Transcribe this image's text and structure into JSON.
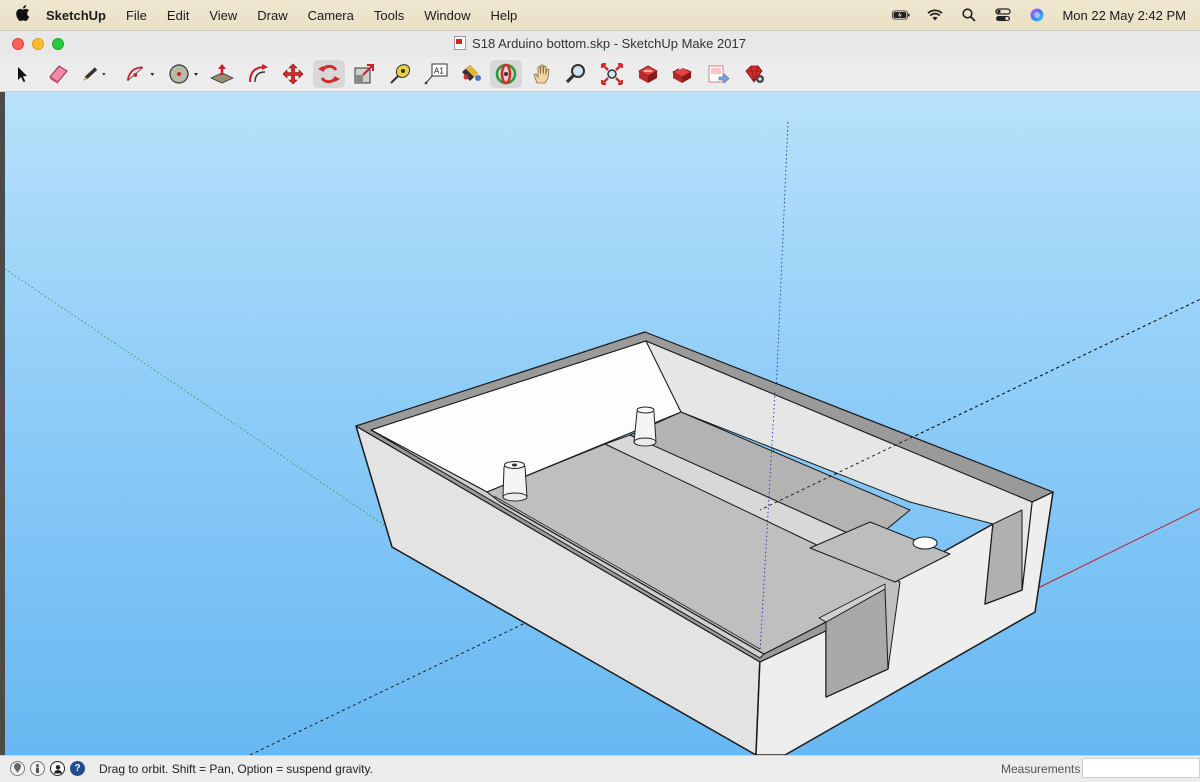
{
  "menubar": {
    "app_name": "SketchUp",
    "menus": [
      "File",
      "Edit",
      "View",
      "Draw",
      "Camera",
      "Tools",
      "Window",
      "Help"
    ],
    "clock": "Mon 22 May  2:42 PM"
  },
  "window": {
    "title": "S18 Arduino bottom.skp - SketchUp Make 2017"
  },
  "toolbar": {
    "tools": [
      {
        "name": "select",
        "icon": "arrow-cursor-icon"
      },
      {
        "name": "eraser",
        "icon": "eraser-icon"
      },
      {
        "name": "line",
        "icon": "pencil-icon",
        "has_dropdown": true
      },
      {
        "name": "arc",
        "icon": "arc-icon",
        "has_dropdown": true
      },
      {
        "name": "shapes",
        "icon": "circle-shape-icon",
        "has_dropdown": true
      },
      {
        "name": "push-pull",
        "icon": "push-pull-icon"
      },
      {
        "name": "offset",
        "icon": "offset-icon"
      },
      {
        "name": "move",
        "icon": "move-icon"
      },
      {
        "name": "rotate",
        "icon": "rotate-icon"
      },
      {
        "name": "scale",
        "icon": "scale-icon"
      },
      {
        "name": "tape-measure",
        "icon": "tape-measure-icon"
      },
      {
        "name": "text",
        "icon": "text-icon",
        "label": "A1"
      },
      {
        "name": "paint-bucket",
        "icon": "paint-bucket-icon"
      },
      {
        "name": "orbit",
        "icon": "orbit-icon",
        "active": true
      },
      {
        "name": "pan",
        "icon": "hand-icon"
      },
      {
        "name": "zoom",
        "icon": "magnifier-icon"
      },
      {
        "name": "zoom-extents",
        "icon": "zoom-extents-icon"
      },
      {
        "name": "3d-warehouse",
        "icon": "warehouse-icon"
      },
      {
        "name": "extension-warehouse",
        "icon": "extension-warehouse-icon"
      },
      {
        "name": "send-to-layout",
        "icon": "layout-icon"
      },
      {
        "name": "extension-manager",
        "icon": "ruby-gear-icon"
      }
    ]
  },
  "statusbar": {
    "message": "Drag to orbit. Shift = Pan, Option = suspend gravity.",
    "measurements_label": "Measurements",
    "measurements_value": ""
  },
  "colors": {
    "sky_top": "#b9e1fb",
    "sky_bottom": "#67b8f2",
    "red_axis": "#c8202a",
    "green_axis": "#2ea043",
    "blue_axis": "#2a2acb"
  }
}
